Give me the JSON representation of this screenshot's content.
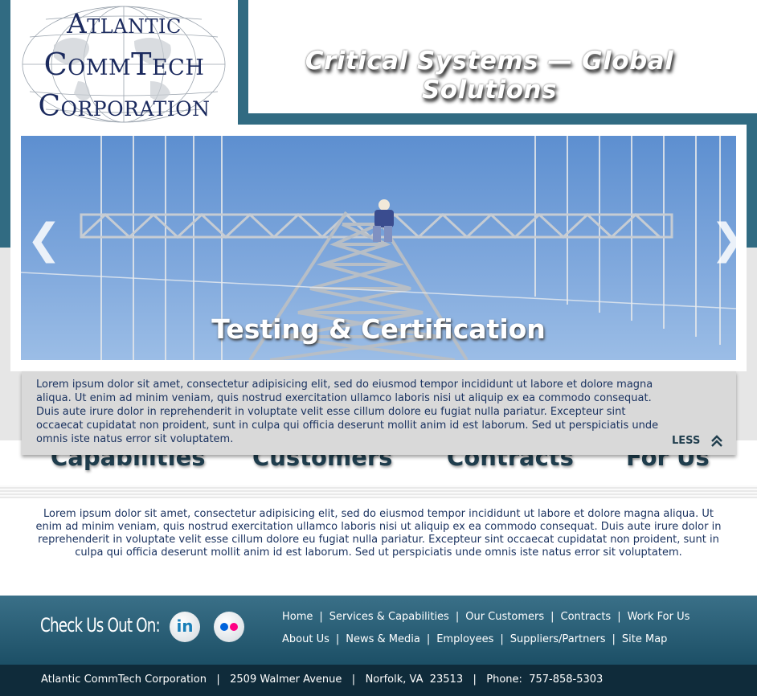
{
  "logo": {
    "line1": "Atlantic",
    "line2": "CommTech",
    "line3": "Corporation"
  },
  "header": {
    "tagline": "Critical Systems — Global Solutions"
  },
  "slider": {
    "caption": "Testing & Certification",
    "prev_icon": "chevron-left-icon",
    "next_icon": "chevron-right-icon"
  },
  "detail_panel": {
    "text": "Lorem ipsum dolor sit amet, consectetur adipisicing elit, sed do eiusmod tempor incididunt ut labore et dolore magna aliqua. Ut enim ad minim veniam, quis nostrud exercitation ullamco laboris nisi ut aliquip ex ea commodo consequat. Duis aute irure dolor in reprehenderit in voluptate velit esse cillum dolore eu fugiat nulla pariatur. Excepteur sint occaecat cupidatat non proident, sunt in culpa qui officia deserunt mollit anim id est laborum. Sed ut perspiciatis unde omnis iste natus error sit voluptatem.",
    "less_label": "LESS",
    "less_icon": "double-chevron-up-icon"
  },
  "nav_headings": [
    "Capabilities",
    "Customers",
    "Contracts",
    "For Us"
  ],
  "body": {
    "text": "Lorem ipsum dolor sit amet, consectetur adipisicing elit, sed do eiusmod tempor incididunt ut labore et dolore magna aliqua. Ut enim ad minim veniam, quis nostrud exercitation ullamco laboris nisi ut aliquip ex ea commodo consequat. Duis aute irure dolor in reprehenderit in voluptate velit esse cillum dolore eu fugiat nulla pariatur. Excepteur sint occaecat cupidatat non proident, sunt in culpa qui officia deserunt mollit anim id est laborum. Sed ut perspiciatis unde omnis iste natus error sit voluptatem."
  },
  "footer": {
    "check_us_out": "Check Us Out On:",
    "social": [
      "linkedin-icon",
      "flickr-icon"
    ],
    "links_row1": [
      "Home",
      "Services & Capabilities",
      "Our Customers",
      "Contracts",
      "Work For Us"
    ],
    "links_row2": [
      "About Us",
      "News & Media",
      "Employees",
      "Suppliers/Partners",
      "Site Map"
    ],
    "address": "Atlantic CommTech Corporation   |   2509 Walmer Avenue   |   Norfolk, VA  23513   |   Phone:  757-858-5303"
  },
  "colors": {
    "brand_teal": "#316b82",
    "navy_text": "#1b3360",
    "footer_dark": "#0f2b3a"
  }
}
